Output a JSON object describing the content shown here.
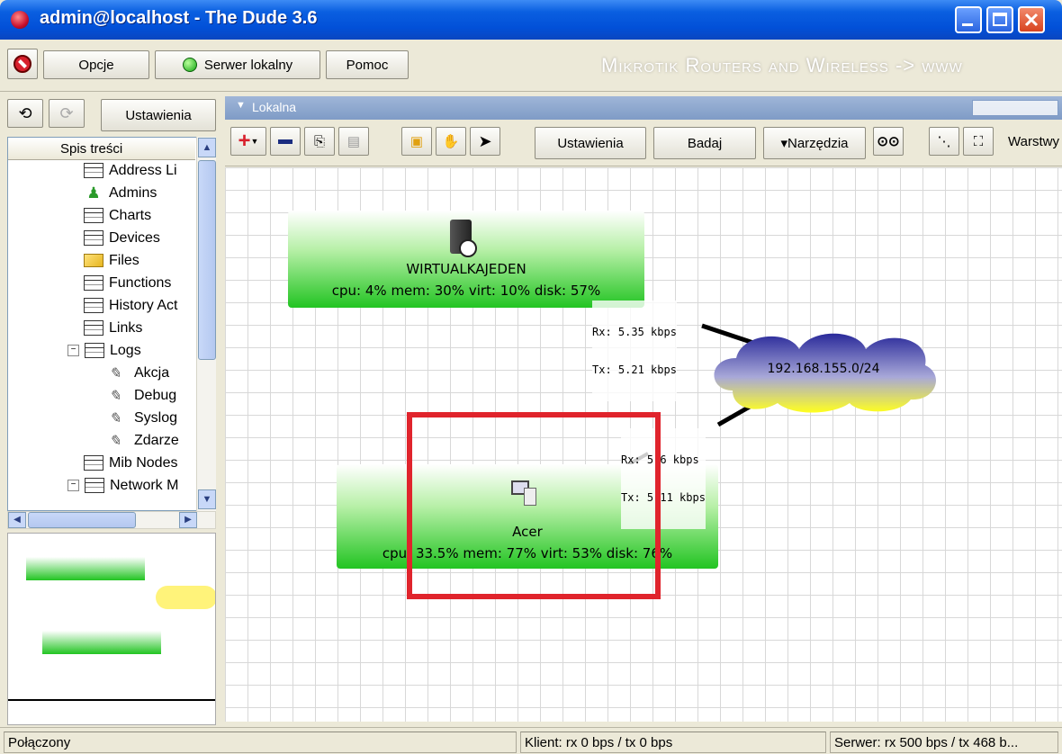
{
  "window": {
    "title": "admin@localhost - The Dude 3.6"
  },
  "menubar": {
    "options_label": "Opcje",
    "server_label": "Serwer lokalny",
    "help_label": "Pomoc",
    "brand_text": "Mikrotik Routers and Wireless -> www"
  },
  "left_toolbar": {
    "settings_label": "Ustawienia"
  },
  "sidebar": {
    "toc_header": "Spis treści",
    "items": [
      {
        "label": "Address Li"
      },
      {
        "label": "Admins"
      },
      {
        "label": "Charts"
      },
      {
        "label": "Devices"
      },
      {
        "label": "Files"
      },
      {
        "label": "Functions"
      },
      {
        "label": "History Act"
      },
      {
        "label": "Links"
      },
      {
        "label": "Logs"
      },
      {
        "label": "Akcja"
      },
      {
        "label": "Debug"
      },
      {
        "label": "Syslog"
      },
      {
        "label": "Zdarze"
      },
      {
        "label": "Mib Nodes"
      },
      {
        "label": "Network M"
      }
    ]
  },
  "map_panel": {
    "title": "Lokalna",
    "settings_label": "Ustawienia",
    "inspect_label": "Badaj",
    "tools_label": "▾Narzędzia",
    "layers_label": "Warstwy"
  },
  "map": {
    "nodes": [
      {
        "name": "WIRTUALKAJEDEN",
        "stats": "cpu: 4% mem: 30% virt: 10% disk: 57%"
      },
      {
        "name": "Acer",
        "stats": "cpu: 33.5% mem: 77% virt: 53% disk: 76%"
      }
    ],
    "network": {
      "label": "192.168.155.0/24"
    },
    "links": [
      {
        "rx": "Rx: 5.35 kbps",
        "tx": "Tx: 5.21 kbps"
      },
      {
        "rx": "Rx: 5.6 kbps",
        "tx": "Tx: 5.11 kbps"
      }
    ],
    "highlight_color": "#e0242c"
  },
  "statusbar": {
    "connection": "Połączony",
    "client": "Klient: rx 0 bps / tx 0 bps",
    "server": "Serwer: rx 500 bps / tx 468 b..."
  }
}
